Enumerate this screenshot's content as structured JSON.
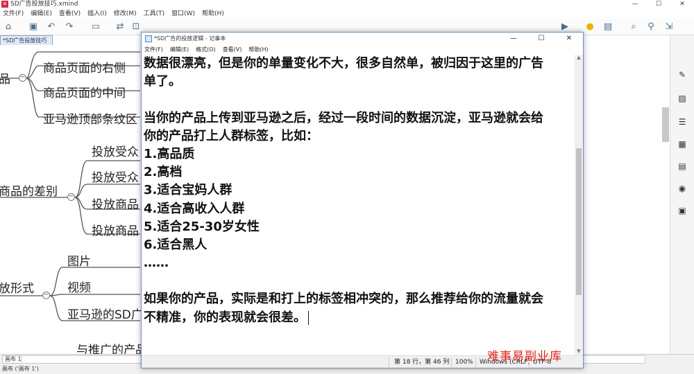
{
  "xmind": {
    "title": "SD广告投放技巧.xmind",
    "menu": [
      "文件(F)",
      "编辑(E)",
      "查看(V)",
      "插入(I)",
      "修改(M)",
      "工具(T)",
      "窗口(W)",
      "帮助(H)"
    ],
    "tab_label": "*SD广告投放技巧",
    "tab_close": "✕",
    "window_controls": [
      "—",
      "☐",
      "✕"
    ],
    "topics": {
      "partial_top": "品",
      "right_side": "商品页面的右侧",
      "middle": "商品页面的中间",
      "top_banner": "亚马逊顶部条纹区",
      "diff": "商品的差别",
      "audience_1": "投放受众",
      "audience_2": "投放受众",
      "product_1": "投放商品",
      "product_2": "投放商品",
      "format": "放形式",
      "image": "图片",
      "video": "视频",
      "sd_ad": "亚马逊的SD广",
      "bottom_partial": "与推广的产品"
    },
    "sheet_tab": "画布 1",
    "status_text": "画布 ('画布 1')"
  },
  "notepad": {
    "title": "*SD广告的投放逻辑 - 记事本",
    "controls": [
      "—",
      "☐",
      "✕"
    ],
    "menu": [
      "文件(F)",
      "编辑(E)",
      "格式(O)",
      "查看(V)",
      "帮助(H)"
    ],
    "lines": [
      "数据很漂亮，但是你的单量变化不大，很多自然单，被归因于这里的广告",
      "单了。",
      "",
      "当你的产品上传到亚马逊之后，经过一段时间的数据沉淀，亚马逊就会给",
      "你的产品打上人群标签，比如：",
      "1.高品质",
      "2.高档",
      "3.适合宝妈人群",
      "4.适合高收入人群",
      "5.适合25-30岁女性",
      "6.适合黑人",
      "……",
      "",
      "如果你的产品，实际是和打上的标签相冲突的，那么推荐给你的流量就会",
      "不精准，你的表现就会很差。"
    ],
    "status": {
      "position": "第 18 行，第 46 列",
      "zoom": "100%",
      "line_ending": "Windows (CRLF)",
      "encoding": "UTF-8"
    }
  },
  "watermark": "难事易副业库",
  "colors": {
    "accent": "#d6254a",
    "line": "#555555",
    "watermark": "#e0231a"
  }
}
